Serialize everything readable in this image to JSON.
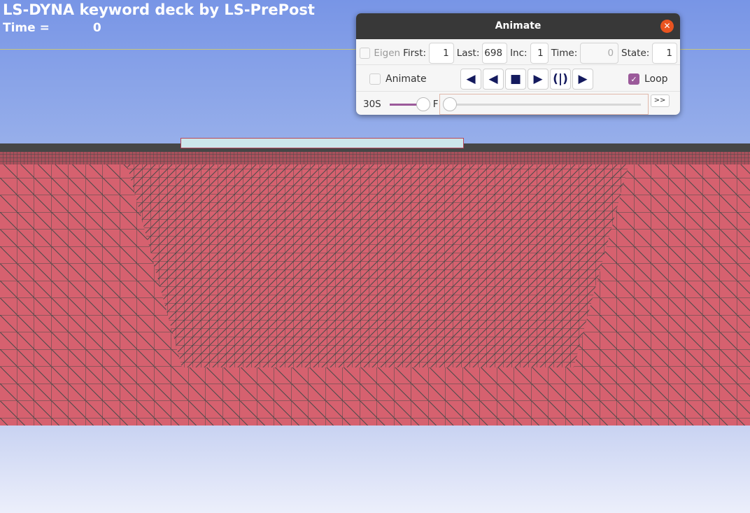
{
  "viewport": {
    "title": "LS-DYNA keyword deck by LS-PrePost",
    "time_label": "Time =",
    "time_value": "0"
  },
  "dialog": {
    "title": "Animate",
    "close_icon": "close-icon",
    "eigen_label": "Eigen",
    "eigen_checked": false,
    "first_label": "First:",
    "first_value": "1",
    "last_label": "Last:",
    "last_value": "698",
    "inc_label": "Inc:",
    "inc_value": "1",
    "time_label": "Time:",
    "time_value": "0",
    "state_label": "State:",
    "state_value": "1",
    "animate_label": "Animate",
    "animate_checked": false,
    "loop_label": "Loop",
    "loop_checked": true,
    "speed_label": "30S",
    "speed_fast_label": "F",
    "speed_fraction": 1.0,
    "frame_fraction": 0.0,
    "more_label": ">>",
    "accent": "#9b5a9a"
  },
  "colors": {
    "mesh": "#d6616f",
    "mesh_lines": "#4a4a4a",
    "plate": "#cde6ea"
  }
}
